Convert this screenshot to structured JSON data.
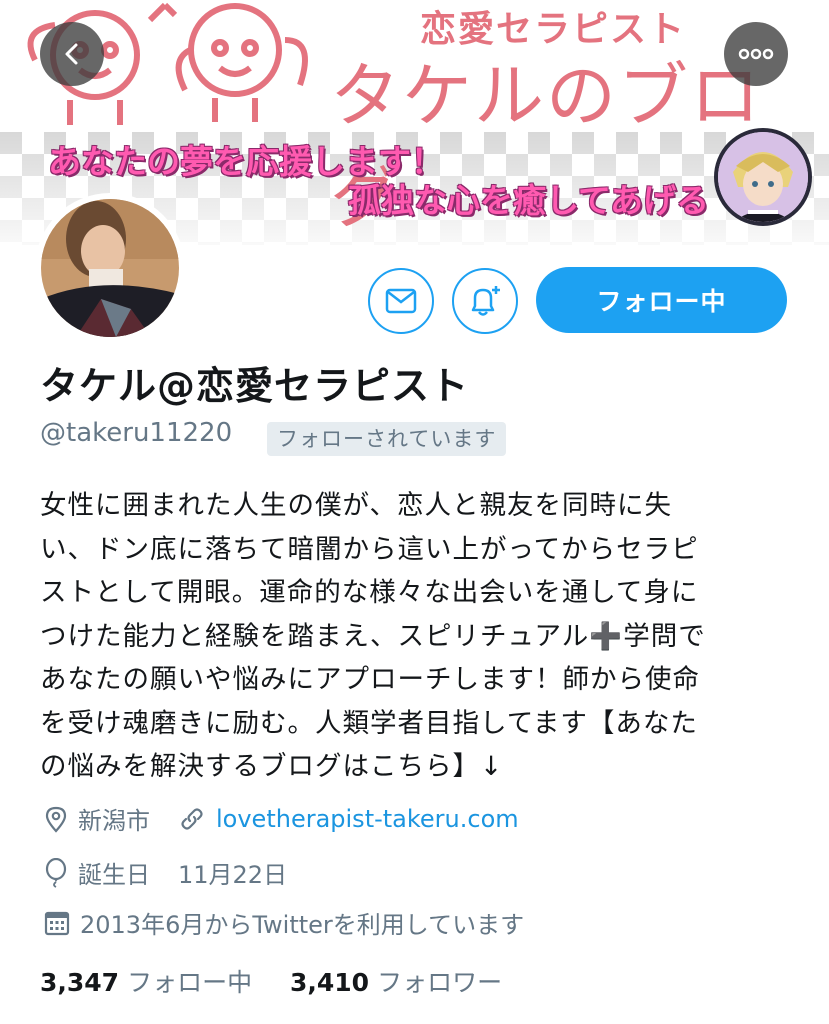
{
  "banner": {
    "subtitle": "恋愛セラピスト",
    "title": "タケルのブログ",
    "line1": "あなたの夢を応援します！",
    "line2": "孤独な心を癒してあげる"
  },
  "profile": {
    "display_name": "タケル@恋愛セラピスト",
    "handle": "@takeru11220",
    "follows_you_badge": "フォローされています",
    "follow_button_label": "フォロー中"
  },
  "bio": {
    "lines": [
      "女性に囲まれた人生の僕が、恋人と親友を同時に失",
      "い、ドン底に落ちて暗闇から這い上がってからセラピ",
      "ストとして開眼。運命的な様々な出会いを通して身に",
      "つけた能力と経験を踏まえ、スピリチュアル➕学問で",
      "あなたの願いや悩みにアプローチします！師から使命",
      "を受け魂磨きに励む。人類学者目指してます【あなた",
      "の悩みを解決するブログはこちら】↓"
    ]
  },
  "meta": {
    "location": "新潟市",
    "website": "lovetherapist-takeru.com",
    "birthday_label": "誕生日",
    "birthday_value": "11月22日",
    "joined": "2013年6月からTwitterを利用しています"
  },
  "stats": {
    "following_count": "3,347",
    "following_label": "フォロー中",
    "followers_count": "3,410",
    "followers_label": "フォロワー"
  },
  "icons": {
    "back": "chevron-left-icon",
    "more": "more-horizontal-icon",
    "dm": "envelope-icon",
    "notify": "bell-plus-icon",
    "location": "location-pin-icon",
    "website": "link-icon",
    "birthday": "balloon-icon",
    "joined": "calendar-icon"
  },
  "colors": {
    "accent": "#1da1f2",
    "link": "#1b95e0",
    "secondary_text": "#657786",
    "banner_pink": "#e4737f"
  }
}
